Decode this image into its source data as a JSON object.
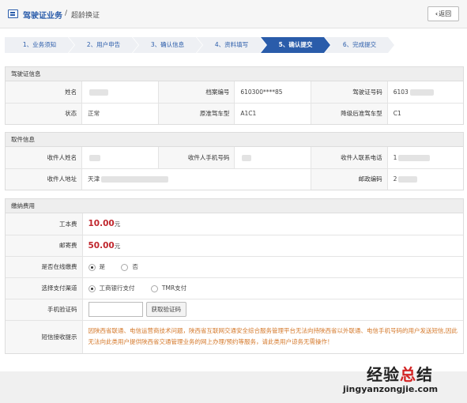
{
  "header": {
    "title": "驾驶证业务",
    "separator": "/",
    "subtitle": "超龄换证",
    "back_label": "返回"
  },
  "steps": [
    {
      "label": "1、业务须知",
      "active": false
    },
    {
      "label": "2、用户申告",
      "active": false
    },
    {
      "label": "3、确认信息",
      "active": false
    },
    {
      "label": "4、资料填写",
      "active": false
    },
    {
      "label": "5、确认提交",
      "active": true
    },
    {
      "label": "6、完成提交",
      "active": false
    }
  ],
  "license": {
    "section_title": "驾驶证信息",
    "name_label": "姓名",
    "name_value": "",
    "file_no_label": "档案编号",
    "file_no_value": "610300****85",
    "license_no_label": "驾驶证号码",
    "license_no_value": "6103",
    "status_label": "状态",
    "status_value": "正常",
    "orig_class_label": "原准驾车型",
    "orig_class_value": "A1C1",
    "down_class_label": "降级后准驾车型",
    "down_class_value": "C1"
  },
  "pickup": {
    "section_title": "取件信息",
    "recipient_label": "收件人姓名",
    "mobile_label": "收件人手机号码",
    "phone_label": "收件人联系电话",
    "phone_value": "1",
    "address_label": "收件人地址",
    "address_value": "天津",
    "postcode_label": "邮政编码",
    "postcode_value": "2"
  },
  "payment": {
    "section_title": "缴纳费用",
    "cost_label": "工本费",
    "cost_value": "10.00",
    "postage_label": "邮寄费",
    "postage_value": "50.00",
    "unit": "元",
    "online_label": "是否在线缴费",
    "online_yes": "是",
    "online_no": "否",
    "channel_label": "选择支付渠道",
    "channel_icbc": "工商银行支付",
    "channel_tmr": "TMR支付",
    "code_label": "手机验证码",
    "code_button": "获取验证码",
    "sms_label": "短信接收提示",
    "sms_text": "因陕西省联通、电信运营商技术问题，陕西省互联网交通安全综合服务管理平台无法向持陕西省以外联通、电信手机号码的用户发送短信,因此无法向此类用户提供陕西省交通管理业务的网上办理/预约等服务，请此类用户谅务无需操作！"
  },
  "watermark": {
    "big_black": "经验",
    "big_red": "总",
    "big_black2": "结",
    "small": "jingyanzongjie.com"
  }
}
